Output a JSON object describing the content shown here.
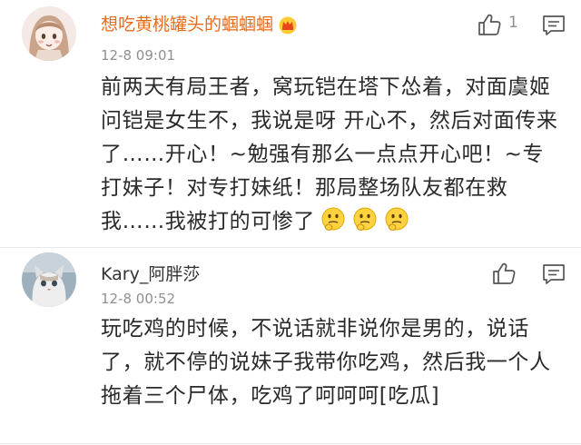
{
  "comments": [
    {
      "username": "想吃黄桃罐头的蝈蝈蝈",
      "time": "12-8 09:01",
      "likes": "1",
      "text": "前两天有局王者，窝玩铠在塔下怂着，对面虞姬问铠是女生不，我说是呀 开心不，然后对面传来了……开心！~勉强有那么一点点开心吧！~专打妹子！对专打妹纸！那局整场队友都在救我……我被打的可惨了",
      "emoji_icons": [
        "thinking-emoji",
        "thinking-emoji",
        "thinking-emoji"
      ],
      "badge_icon": "crown-icon"
    },
    {
      "username": "Kary_阿胖莎",
      "time": "12-8 00:52",
      "likes": "",
      "text": "玩吃鸡的时候，不说话就非说你是男的，说话了，就不停的说妹子我带你吃鸡，然后我一个人拖着三个尸体，吃鸡了呵呵呵[吃瓜]"
    }
  ],
  "colors": {
    "vip_username": "#e86b1a",
    "username": "#333333",
    "meta": "#8f8f8f",
    "divider": "#e8e8e8"
  }
}
